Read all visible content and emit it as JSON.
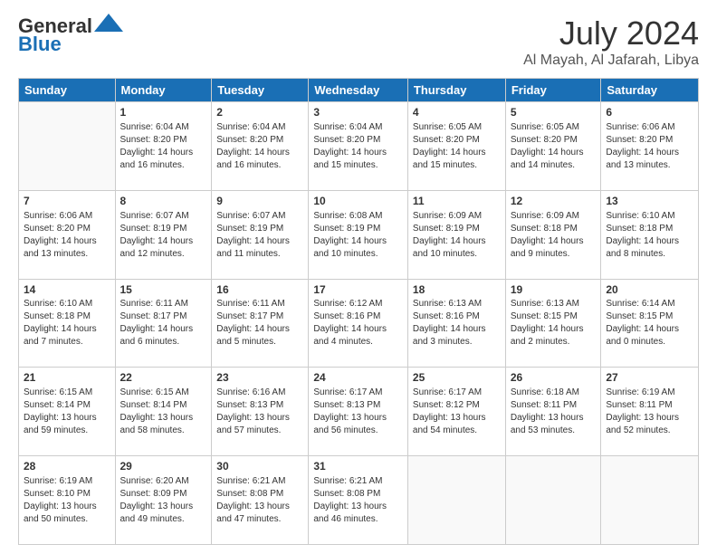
{
  "header": {
    "logo_general": "General",
    "logo_blue": "Blue",
    "month": "July 2024",
    "location": "Al Mayah, Al Jafarah, Libya"
  },
  "weekdays": [
    "Sunday",
    "Monday",
    "Tuesday",
    "Wednesday",
    "Thursday",
    "Friday",
    "Saturday"
  ],
  "weeks": [
    [
      {
        "day": "",
        "info": ""
      },
      {
        "day": "1",
        "info": "Sunrise: 6:04 AM\nSunset: 8:20 PM\nDaylight: 14 hours\nand 16 minutes."
      },
      {
        "day": "2",
        "info": "Sunrise: 6:04 AM\nSunset: 8:20 PM\nDaylight: 14 hours\nand 16 minutes."
      },
      {
        "day": "3",
        "info": "Sunrise: 6:04 AM\nSunset: 8:20 PM\nDaylight: 14 hours\nand 15 minutes."
      },
      {
        "day": "4",
        "info": "Sunrise: 6:05 AM\nSunset: 8:20 PM\nDaylight: 14 hours\nand 15 minutes."
      },
      {
        "day": "5",
        "info": "Sunrise: 6:05 AM\nSunset: 8:20 PM\nDaylight: 14 hours\nand 14 minutes."
      },
      {
        "day": "6",
        "info": "Sunrise: 6:06 AM\nSunset: 8:20 PM\nDaylight: 14 hours\nand 13 minutes."
      }
    ],
    [
      {
        "day": "7",
        "info": "Sunrise: 6:06 AM\nSunset: 8:20 PM\nDaylight: 14 hours\nand 13 minutes."
      },
      {
        "day": "8",
        "info": "Sunrise: 6:07 AM\nSunset: 8:19 PM\nDaylight: 14 hours\nand 12 minutes."
      },
      {
        "day": "9",
        "info": "Sunrise: 6:07 AM\nSunset: 8:19 PM\nDaylight: 14 hours\nand 11 minutes."
      },
      {
        "day": "10",
        "info": "Sunrise: 6:08 AM\nSunset: 8:19 PM\nDaylight: 14 hours\nand 10 minutes."
      },
      {
        "day": "11",
        "info": "Sunrise: 6:09 AM\nSunset: 8:19 PM\nDaylight: 14 hours\nand 10 minutes."
      },
      {
        "day": "12",
        "info": "Sunrise: 6:09 AM\nSunset: 8:18 PM\nDaylight: 14 hours\nand 9 minutes."
      },
      {
        "day": "13",
        "info": "Sunrise: 6:10 AM\nSunset: 8:18 PM\nDaylight: 14 hours\nand 8 minutes."
      }
    ],
    [
      {
        "day": "14",
        "info": "Sunrise: 6:10 AM\nSunset: 8:18 PM\nDaylight: 14 hours\nand 7 minutes."
      },
      {
        "day": "15",
        "info": "Sunrise: 6:11 AM\nSunset: 8:17 PM\nDaylight: 14 hours\nand 6 minutes."
      },
      {
        "day": "16",
        "info": "Sunrise: 6:11 AM\nSunset: 8:17 PM\nDaylight: 14 hours\nand 5 minutes."
      },
      {
        "day": "17",
        "info": "Sunrise: 6:12 AM\nSunset: 8:16 PM\nDaylight: 14 hours\nand 4 minutes."
      },
      {
        "day": "18",
        "info": "Sunrise: 6:13 AM\nSunset: 8:16 PM\nDaylight: 14 hours\nand 3 minutes."
      },
      {
        "day": "19",
        "info": "Sunrise: 6:13 AM\nSunset: 8:15 PM\nDaylight: 14 hours\nand 2 minutes."
      },
      {
        "day": "20",
        "info": "Sunrise: 6:14 AM\nSunset: 8:15 PM\nDaylight: 14 hours\nand 0 minutes."
      }
    ],
    [
      {
        "day": "21",
        "info": "Sunrise: 6:15 AM\nSunset: 8:14 PM\nDaylight: 13 hours\nand 59 minutes."
      },
      {
        "day": "22",
        "info": "Sunrise: 6:15 AM\nSunset: 8:14 PM\nDaylight: 13 hours\nand 58 minutes."
      },
      {
        "day": "23",
        "info": "Sunrise: 6:16 AM\nSunset: 8:13 PM\nDaylight: 13 hours\nand 57 minutes."
      },
      {
        "day": "24",
        "info": "Sunrise: 6:17 AM\nSunset: 8:13 PM\nDaylight: 13 hours\nand 56 minutes."
      },
      {
        "day": "25",
        "info": "Sunrise: 6:17 AM\nSunset: 8:12 PM\nDaylight: 13 hours\nand 54 minutes."
      },
      {
        "day": "26",
        "info": "Sunrise: 6:18 AM\nSunset: 8:11 PM\nDaylight: 13 hours\nand 53 minutes."
      },
      {
        "day": "27",
        "info": "Sunrise: 6:19 AM\nSunset: 8:11 PM\nDaylight: 13 hours\nand 52 minutes."
      }
    ],
    [
      {
        "day": "28",
        "info": "Sunrise: 6:19 AM\nSunset: 8:10 PM\nDaylight: 13 hours\nand 50 minutes."
      },
      {
        "day": "29",
        "info": "Sunrise: 6:20 AM\nSunset: 8:09 PM\nDaylight: 13 hours\nand 49 minutes."
      },
      {
        "day": "30",
        "info": "Sunrise: 6:21 AM\nSunset: 8:08 PM\nDaylight: 13 hours\nand 47 minutes."
      },
      {
        "day": "31",
        "info": "Sunrise: 6:21 AM\nSunset: 8:08 PM\nDaylight: 13 hours\nand 46 minutes."
      },
      {
        "day": "",
        "info": ""
      },
      {
        "day": "",
        "info": ""
      },
      {
        "day": "",
        "info": ""
      }
    ]
  ]
}
